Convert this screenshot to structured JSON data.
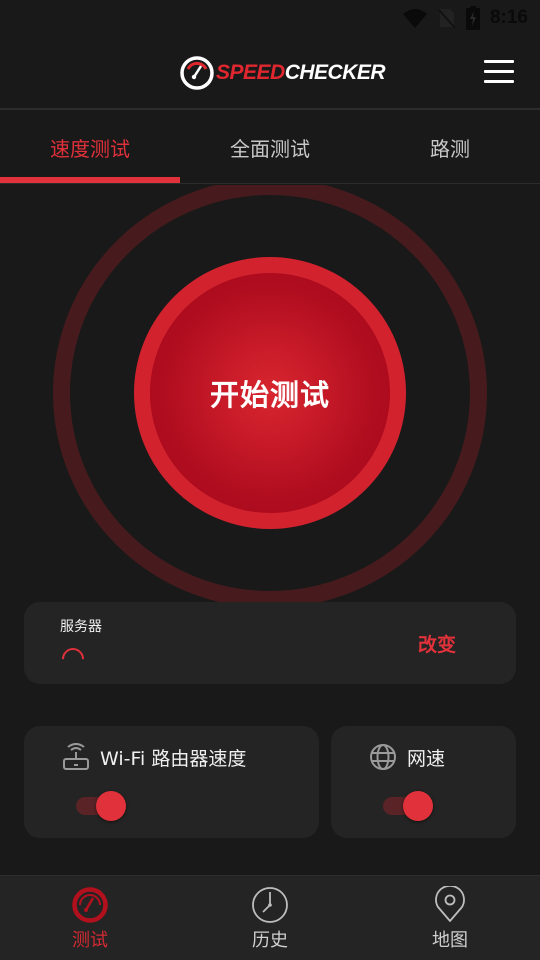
{
  "status_bar": {
    "time": "8:16",
    "icons": [
      "wifi-signal-icon",
      "no-sim-icon",
      "battery-charging-icon"
    ]
  },
  "app_bar": {
    "logo_part1": "SPEED",
    "logo_part2": "CHECKER",
    "menu_icon": "hamburger-menu-icon"
  },
  "tabs": [
    {
      "label": "速度测试",
      "active": true
    },
    {
      "label": "全面测试",
      "active": false
    },
    {
      "label": "路测",
      "active": false
    }
  ],
  "start_button": {
    "label": "开始测试"
  },
  "server": {
    "label": "服务器",
    "status": "loading",
    "change_label": "改变"
  },
  "options": [
    {
      "icon": "router-icon",
      "label": "Wi-Fi 路由器速度",
      "enabled": true
    },
    {
      "icon": "globe-icon",
      "label": "网速",
      "enabled": true
    }
  ],
  "bottom_nav": [
    {
      "icon": "speedometer-icon",
      "label": "测试",
      "active": true
    },
    {
      "icon": "clock-icon",
      "label": "历史",
      "active": false
    },
    {
      "icon": "map-pin-icon",
      "label": "地图",
      "active": false
    }
  ],
  "colors": {
    "accent": "#e1313a",
    "background": "#191919",
    "card": "#242424",
    "ring": "#471b1d"
  }
}
